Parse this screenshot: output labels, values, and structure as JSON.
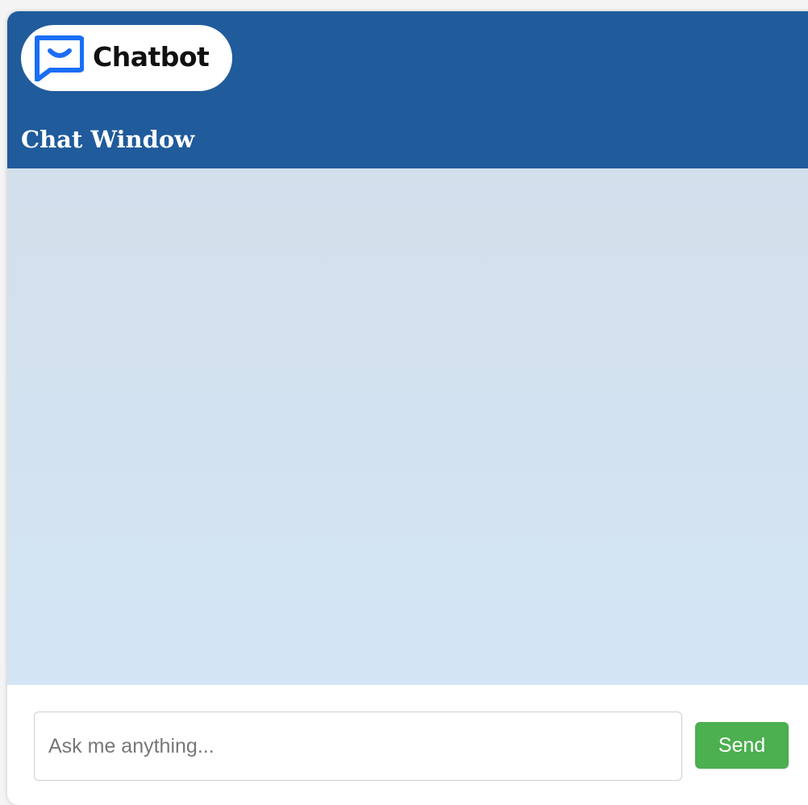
{
  "header": {
    "logo_text": "Chatbot",
    "logo_icon": "chat-bubble-smile-icon",
    "title": "Chat Window"
  },
  "input": {
    "placeholder": "Ask me anything...",
    "value": ""
  },
  "send_button": {
    "label": "Send"
  },
  "colors": {
    "header_bg": "#205b9c",
    "messages_bg": "#d3e2f0",
    "send_bg": "#4caf50",
    "logo_accent": "#1a6ef5"
  }
}
